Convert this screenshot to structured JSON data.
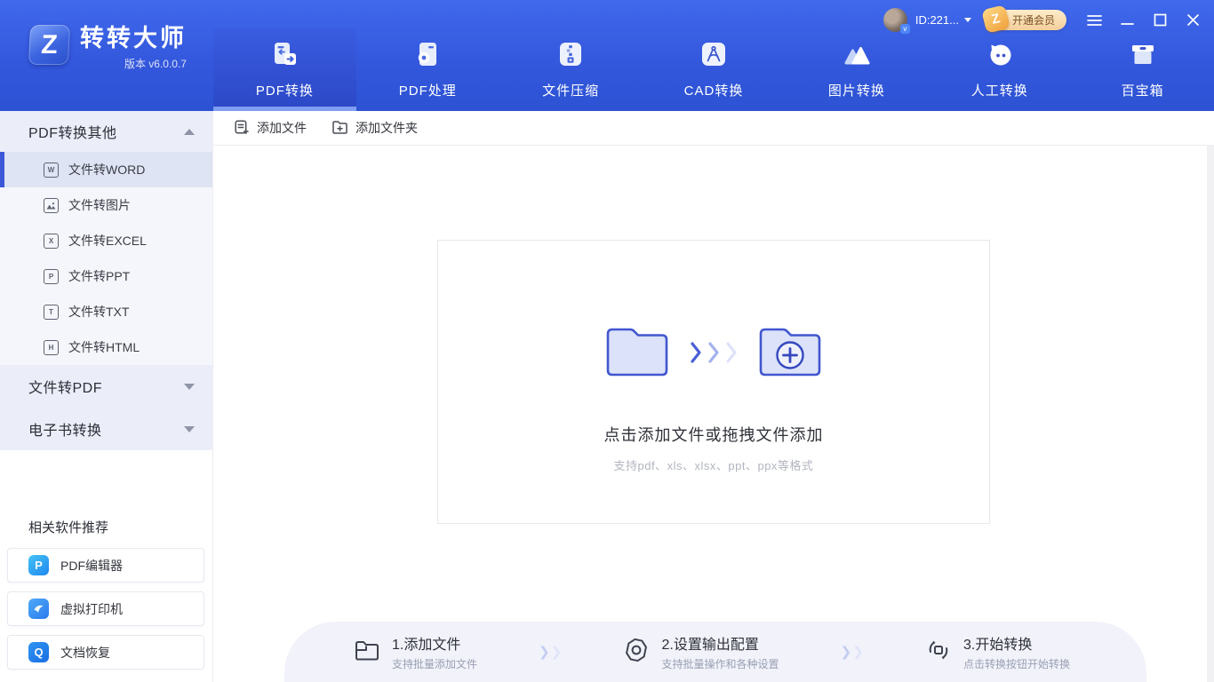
{
  "app": {
    "name": "转转大师",
    "version": "版本 v6.0.0.7",
    "logo_letter": "Z"
  },
  "titlebar": {
    "user_id": "ID:221...",
    "vip_label": "开通会员",
    "vip_badge": "Z",
    "avatar_badge": "v"
  },
  "nav": {
    "tabs": [
      {
        "label": "PDF转换",
        "icon": "pdf-convert-icon",
        "active": true
      },
      {
        "label": "PDF处理",
        "icon": "pdf-process-icon",
        "active": false
      },
      {
        "label": "文件压缩",
        "icon": "file-compress-icon",
        "active": false
      },
      {
        "label": "CAD转换",
        "icon": "cad-convert-icon",
        "active": false
      },
      {
        "label": "图片转换",
        "icon": "image-convert-icon",
        "active": false
      },
      {
        "label": "人工转换",
        "icon": "manual-convert-icon",
        "active": false
      },
      {
        "label": "百宝箱",
        "icon": "toolbox-icon",
        "active": false
      }
    ]
  },
  "sidebar": {
    "groups": [
      {
        "label": "PDF转换其他",
        "state": "expanded"
      },
      {
        "label": "文件转PDF",
        "state": "collapsed"
      },
      {
        "label": "电子书转换",
        "state": "collapsed"
      }
    ],
    "items": [
      {
        "label": "文件转WORD",
        "icon_letter": "W",
        "selected": true
      },
      {
        "label": "文件转图片",
        "icon_letter": "",
        "selected": false
      },
      {
        "label": "文件转EXCEL",
        "icon_letter": "X",
        "selected": false
      },
      {
        "label": "文件转PPT",
        "icon_letter": "P",
        "selected": false
      },
      {
        "label": "文件转TXT",
        "icon_letter": "T",
        "selected": false
      },
      {
        "label": "文件转HTML",
        "icon_letter": "H",
        "selected": false
      }
    ],
    "recommend": {
      "title": "相关软件推荐",
      "items": [
        {
          "label": "PDF编辑器",
          "icon_letter": "P"
        },
        {
          "label": "虚拟打印机",
          "icon_letter": ""
        },
        {
          "label": "文档恢复",
          "icon_letter": "Q"
        }
      ]
    }
  },
  "toolbar": {
    "add_file_label": "添加文件",
    "add_folder_label": "添加文件夹"
  },
  "dropzone": {
    "title": "点击添加文件或拖拽文件添加",
    "subtitle": "支持pdf、xls、xlsx、ppt、ppx等格式"
  },
  "steps": [
    {
      "title": "1.添加文件",
      "desc": "支持批量添加文件"
    },
    {
      "title": "2.设置输出配置",
      "desc": "支持批量操作和各种设置"
    },
    {
      "title": "3.开始转换",
      "desc": "点击转换按钮开始转换"
    }
  ],
  "colors": {
    "header_blue_top": "#4069ec",
    "header_blue_bottom": "#2d52d3",
    "active_tab": "#2b48c6",
    "active_tab_underline": "#7f9df2",
    "sidebar_head_bg": "#ebeef8",
    "sidebar_items_bg": "#f5f6fb",
    "selected_item_bg": "#dfe4f4",
    "accent": "#3c57d8",
    "vip_gold": "#f4cf9a",
    "steps_bar_bg": "#f1f2fa"
  }
}
